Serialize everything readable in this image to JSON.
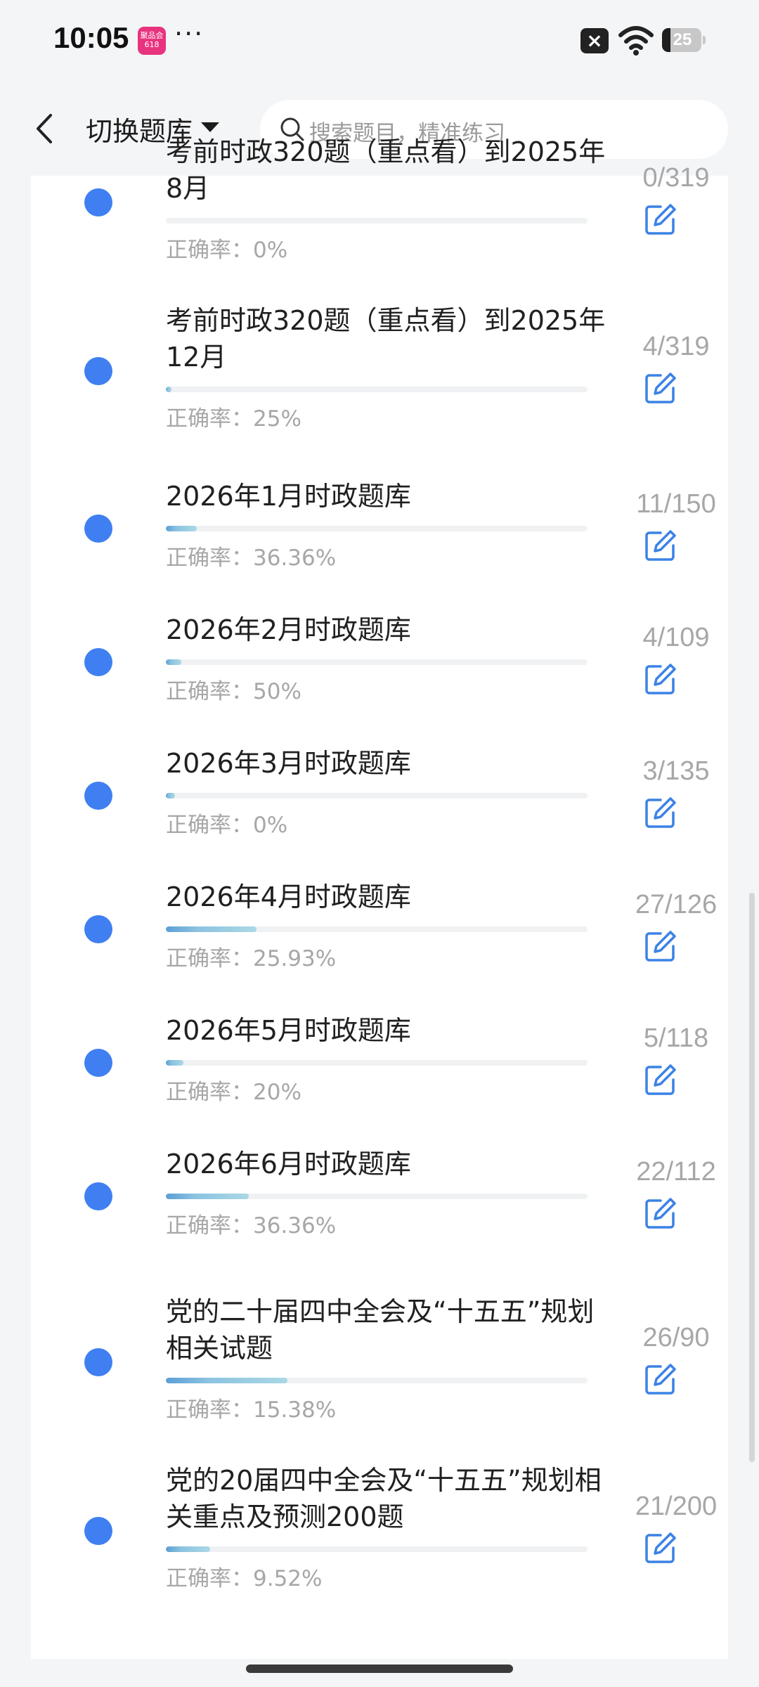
{
  "status_bar": {
    "time": "10:05",
    "app_badge": "聚品会 618",
    "more": "···",
    "battery": "25"
  },
  "header": {
    "switch_label": "切换题库",
    "search_placeholder": "搜索题目，精准练习"
  },
  "accuracy_prefix": "正确率：",
  "items": [
    {
      "title": "考前时政320题（重点看）到2025年8月",
      "count": "0/319",
      "accuracy": "0%",
      "progress": 0.0
    },
    {
      "title": "考前时政320题（重点看）到2025年12月",
      "count": "4/319",
      "accuracy": "25%",
      "progress": 0.0125
    },
    {
      "title": "2026年1月时政题库",
      "count": "11/150",
      "accuracy": "36.36%",
      "progress": 0.0733
    },
    {
      "title": "2026年2月时政题库",
      "count": "4/109",
      "accuracy": "50%",
      "progress": 0.0367
    },
    {
      "title": "2026年3月时政题库",
      "count": "3/135",
      "accuracy": "0%",
      "progress": 0.0222
    },
    {
      "title": "2026年4月时政题库",
      "count": "27/126",
      "accuracy": "25.93%",
      "progress": 0.2143
    },
    {
      "title": "2026年5月时政题库",
      "count": "5/118",
      "accuracy": "20%",
      "progress": 0.0424
    },
    {
      "title": "2026年6月时政题库",
      "count": "22/112",
      "accuracy": "36.36%",
      "progress": 0.1964
    },
    {
      "title": "党的二十届四中全会及“十五五”规划相关试题",
      "count": "26/90",
      "accuracy": "15.38%",
      "progress": 0.2889
    },
    {
      "title": "党的20届四中全会及“十五五”规划相关重点及预测200题",
      "count": "21/200",
      "accuracy": "9.52%",
      "progress": 0.105
    }
  ],
  "colors": {
    "accent": "#3f7ff1",
    "edit_icon": "#3b82e6",
    "muted_text": "#a7a7a7"
  }
}
